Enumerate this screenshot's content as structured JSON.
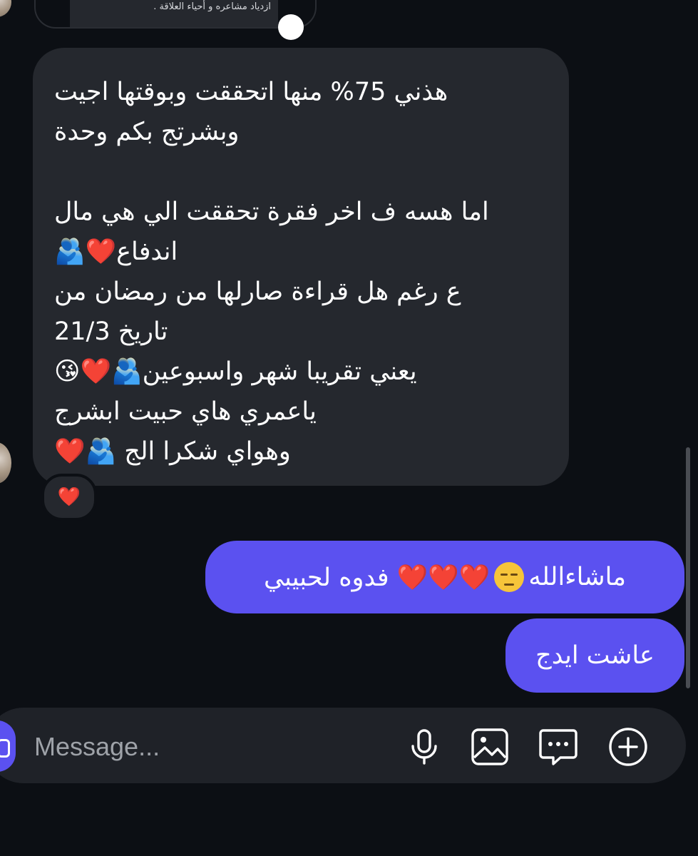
{
  "top_card": {
    "preview_text": "ازدياد مشاعره و أحياء العلاقة ."
  },
  "incoming_message": {
    "lines": [
      "هذني 75% منها اتحققت وبوقتها اجيت",
      "وبشرتج بكم وحدة",
      "",
      "اما هسه ف اخر فقرة تحققت الي هي مال",
      "اندفاع❤️🫂",
      "ع رغم هل قراءة صارلها من رمضان من",
      "تاريخ 21/3",
      "يعني تقريبا شهر واسبوعين🫂❤️😘",
      "ياعمري هاي حبيت ابشرج",
      "وهواي شكرا الج 🫂❤️"
    ],
    "reaction": "❤️"
  },
  "outgoing_messages": [
    {
      "text_prefix": "ماشاءالله",
      "text_suffix": "❤️❤️❤️ فدوه لحبيبي"
    },
    {
      "text": "عاشت ايدج"
    }
  ],
  "composer": {
    "placeholder": "Message...",
    "icons": [
      "microphone-icon",
      "image-icon",
      "chat-bubble-icon",
      "plus-circle-icon"
    ]
  },
  "colors": {
    "background": "#0c0f14",
    "incoming_bubble": "#25282e",
    "outgoing_bubble": "#5b51f0",
    "composer": "#1f2228"
  }
}
